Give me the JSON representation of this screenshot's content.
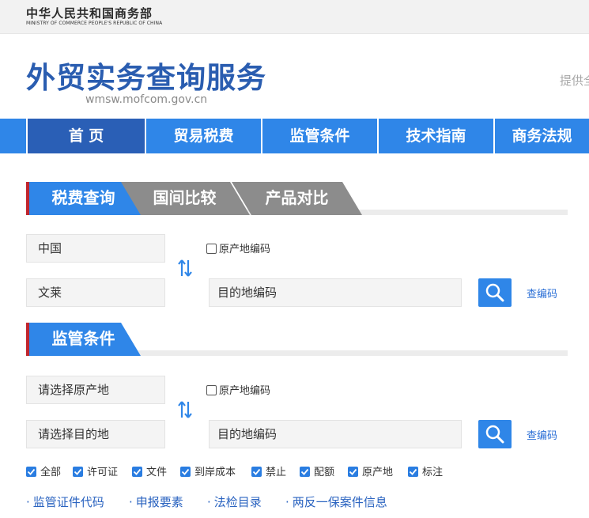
{
  "header": {
    "ministry_cn": "中华人民共和国商务部",
    "ministry_en": "MINISTRY OF COMMERCE PEOPLE'S REPUBLIC OF CHINA",
    "site_title": "外贸实务查询服务",
    "site_url": "wmsw.mofcom.gov.cn",
    "provide_text": "提供全"
  },
  "nav": {
    "items": [
      {
        "label": "首 页"
      },
      {
        "label": "贸易税费"
      },
      {
        "label": "监管条件"
      },
      {
        "label": "技术指南"
      },
      {
        "label": "商务法规"
      }
    ]
  },
  "tabs": {
    "items": [
      {
        "label": "税费查询"
      },
      {
        "label": "国间比较"
      },
      {
        "label": "产品对比"
      }
    ]
  },
  "tariff_query": {
    "origin_value": "中国",
    "destination_value": "文莱",
    "origin_code_label": "原产地编码",
    "destination_code_placeholder": "目的地编码",
    "lookup_code_label": "查编码"
  },
  "regulatory": {
    "section_title": "监管条件",
    "origin_placeholder": "请选择原产地",
    "destination_placeholder": "请选择目的地",
    "origin_code_label": "原产地编码",
    "destination_code_placeholder": "目的地编码",
    "lookup_code_label": "查编码",
    "filters": [
      {
        "label": "全部",
        "checked": true
      },
      {
        "label": "许可证",
        "checked": true
      },
      {
        "label": "文件",
        "checked": true
      },
      {
        "label": "到岸成本",
        "checked": true
      },
      {
        "label": "禁止",
        "checked": true
      },
      {
        "label": "配额",
        "checked": true
      },
      {
        "label": "原产地",
        "checked": true
      },
      {
        "label": "标注",
        "checked": true
      }
    ],
    "links": [
      {
        "label": "监管证件代码"
      },
      {
        "label": "申报要素"
      },
      {
        "label": "法检目录"
      },
      {
        "label": "两反一保案件信息"
      }
    ]
  },
  "colors": {
    "primary_blue": "#2f86e8",
    "active_nav": "#2a5fb6",
    "title_blue": "#2a5db0",
    "accent_red": "#c0262e",
    "inactive_tab_grey": "#8c8c8c"
  }
}
